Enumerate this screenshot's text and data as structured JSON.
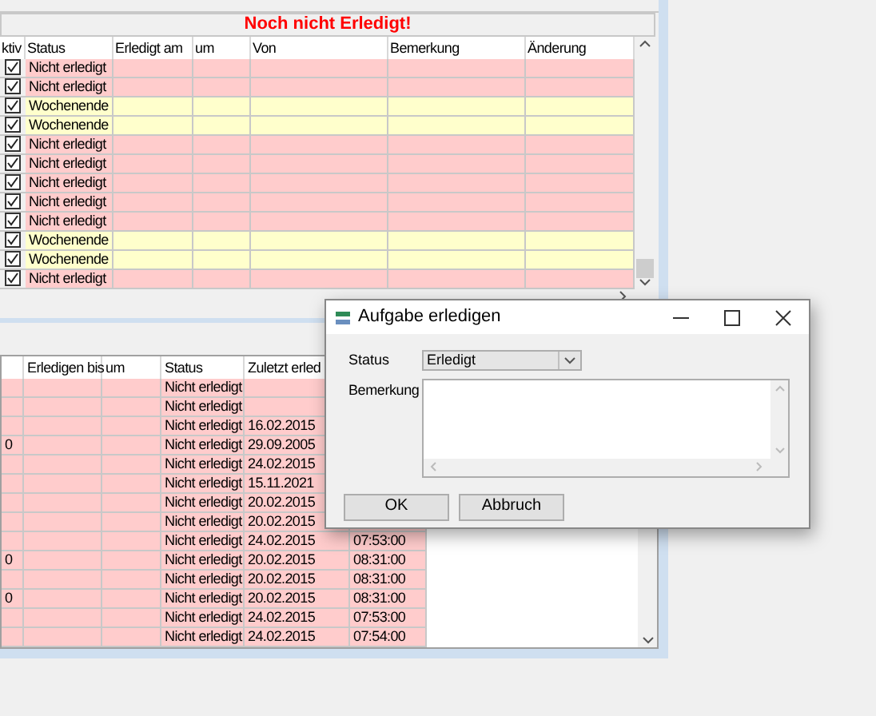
{
  "top_panel": {
    "banner": "Noch nicht Erledigt!",
    "columns": [
      "ktiv",
      "Status",
      "Erledigt am",
      "um",
      "Von",
      "Bemerkung",
      "Änderung"
    ],
    "rows": [
      {
        "checked": true,
        "status": "Nicht erledigt",
        "kind": "open"
      },
      {
        "checked": true,
        "status": "Nicht erledigt",
        "kind": "open"
      },
      {
        "checked": true,
        "status": "Wochenende",
        "kind": "weekend"
      },
      {
        "checked": true,
        "status": "Wochenende",
        "kind": "weekend"
      },
      {
        "checked": true,
        "status": "Nicht erledigt",
        "kind": "open"
      },
      {
        "checked": true,
        "status": "Nicht erledigt",
        "kind": "open"
      },
      {
        "checked": true,
        "status": "Nicht erledigt",
        "kind": "open"
      },
      {
        "checked": true,
        "status": "Nicht erledigt",
        "kind": "open"
      },
      {
        "checked": true,
        "status": "Nicht erledigt",
        "kind": "open"
      },
      {
        "checked": true,
        "status": "Wochenende",
        "kind": "weekend"
      },
      {
        "checked": true,
        "status": "Wochenende",
        "kind": "weekend"
      },
      {
        "checked": true,
        "status": "Nicht erledigt",
        "kind": "open"
      }
    ]
  },
  "bottom_panel": {
    "columns": [
      "Erledigen bis",
      "um",
      "Status",
      "Zuletzt erled"
    ],
    "rows": [
      {
        "column_1": "",
        "status": "Nicht erledigt",
        "last_done": "",
        "time": ""
      },
      {
        "column_1": "",
        "status": "Nicht erledigt",
        "last_done": "",
        "time": ""
      },
      {
        "column_1": "",
        "status": "Nicht erledigt",
        "last_done": "16.02.2015",
        "time": ""
      },
      {
        "column_1": "0",
        "status": "Nicht erledigt",
        "last_done": "29.09.2005",
        "time": ""
      },
      {
        "column_1": "",
        "status": "Nicht erledigt",
        "last_done": "24.02.2015",
        "time": ""
      },
      {
        "column_1": "",
        "status": "Nicht erledigt",
        "last_done": "15.11.2021",
        "time": ""
      },
      {
        "column_1": "",
        "status": "Nicht erledigt",
        "last_done": "20.02.2015",
        "time": ""
      },
      {
        "column_1": "",
        "status": "Nicht erledigt",
        "last_done": "20.02.2015",
        "time": ""
      },
      {
        "column_1": "",
        "status": "Nicht erledigt",
        "last_done": "24.02.2015",
        "time": "07:53:00"
      },
      {
        "column_1": "0",
        "status": "Nicht erledigt",
        "last_done": "20.02.2015",
        "time": "08:31:00"
      },
      {
        "column_1": "",
        "status": "Nicht erledigt",
        "last_done": "20.02.2015",
        "time": "08:31:00"
      },
      {
        "column_1": "0",
        "status": "Nicht erledigt",
        "last_done": "20.02.2015",
        "time": "08:31:00"
      },
      {
        "column_1": "",
        "status": "Nicht erledigt",
        "last_done": "24.02.2015",
        "time": "07:53:00"
      },
      {
        "column_1": "",
        "status": "Nicht erledigt",
        "last_done": "24.02.2015",
        "time": "07:54:00"
      }
    ]
  },
  "dialog": {
    "title": "Aufgabe erledigen",
    "status_label": "Status",
    "status_value": "Erledigt",
    "remark_label": "Bemerkung",
    "buttons": [
      "OK",
      "Abbruch"
    ]
  }
}
